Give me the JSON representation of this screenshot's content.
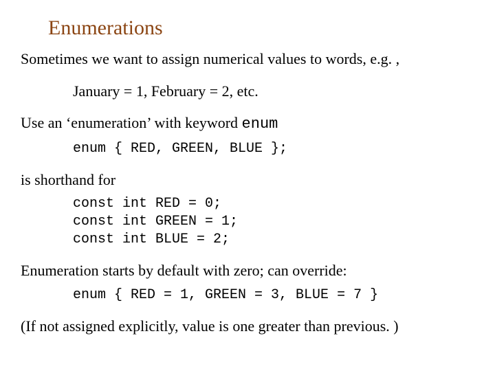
{
  "title": "Enumerations",
  "lines": {
    "intro": "Sometimes we want to assign numerical values to words, e.g. ,",
    "example_months": "January = 1, February = 2, etc.",
    "use_enum_prefix": "Use an ‘enumeration’ with keyword ",
    "enum_keyword": "enum",
    "enum_rgb": "enum { RED, GREEN, BLUE };",
    "shorthand": "is shorthand for",
    "const_block": "const int RED = 0;\nconst int GREEN = 1;\nconst int BLUE = 2;",
    "override": "Enumeration starts by default with zero; can override:",
    "enum_override": "enum { RED = 1, GREEN = 3, BLUE = 7 }",
    "note": "(If not assigned explicitly, value is one greater than previous. )"
  }
}
